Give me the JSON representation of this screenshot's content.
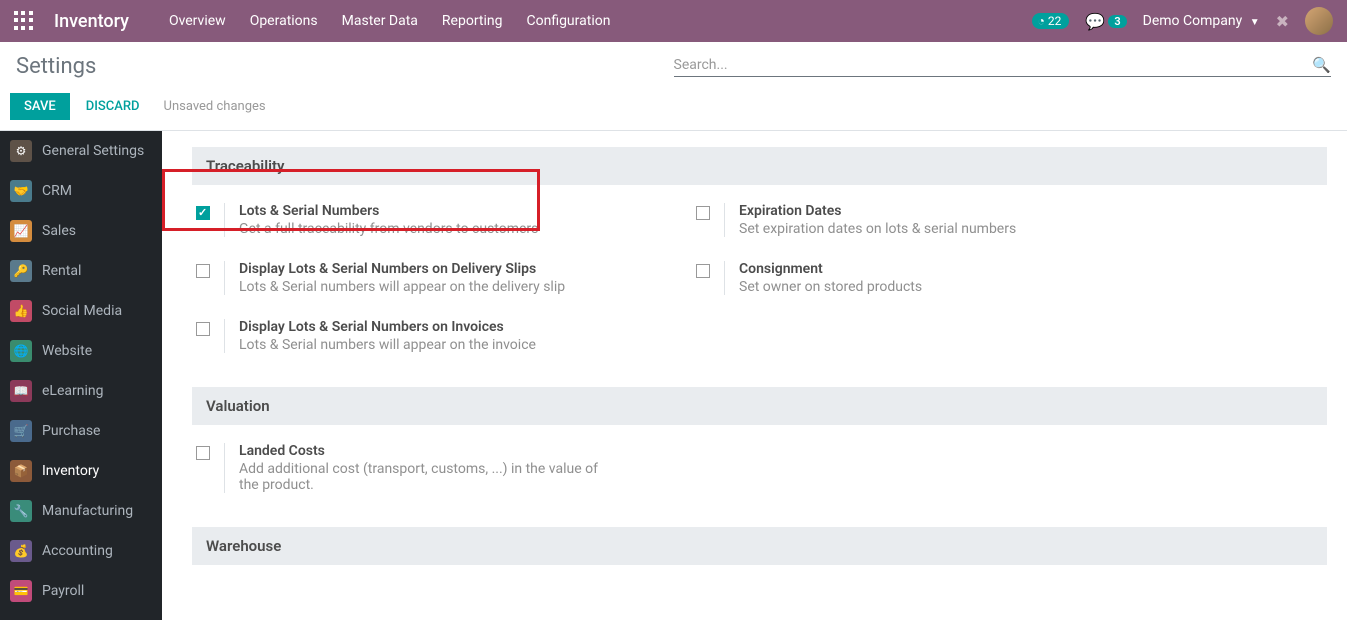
{
  "navbar": {
    "brand": "Inventory",
    "menu": [
      "Overview",
      "Operations",
      "Master Data",
      "Reporting",
      "Configuration"
    ],
    "clock_count": "22",
    "chat_count": "3",
    "company": "Demo Company"
  },
  "control_panel": {
    "title": "Settings",
    "search_placeholder": "Search...",
    "save_label": "SAVE",
    "discard_label": "DISCARD",
    "unsaved_label": "Unsaved changes"
  },
  "sidebar": {
    "items": [
      {
        "label": "General Settings"
      },
      {
        "label": "CRM"
      },
      {
        "label": "Sales"
      },
      {
        "label": "Rental"
      },
      {
        "label": "Social Media"
      },
      {
        "label": "Website"
      },
      {
        "label": "eLearning"
      },
      {
        "label": "Purchase"
      },
      {
        "label": "Inventory"
      },
      {
        "label": "Manufacturing"
      },
      {
        "label": "Accounting"
      },
      {
        "label": "Payroll"
      }
    ]
  },
  "sections": {
    "traceability": {
      "title": "Traceability",
      "left": [
        {
          "title": "Lots & Serial Numbers",
          "desc": "Get a full traceability from vendors to customers",
          "checked": true
        },
        {
          "title": "Display Lots & Serial Numbers on Delivery Slips",
          "desc": "Lots & Serial numbers will appear on the delivery slip",
          "checked": false
        },
        {
          "title": "Display Lots & Serial Numbers on Invoices",
          "desc": "Lots & Serial numbers will appear on the invoice",
          "checked": false
        }
      ],
      "right": [
        {
          "title": "Expiration Dates",
          "desc": "Set expiration dates on lots & serial numbers",
          "checked": false
        },
        {
          "title": "Consignment",
          "desc": "Set owner on stored products",
          "checked": false
        }
      ]
    },
    "valuation": {
      "title": "Valuation",
      "left": [
        {
          "title": "Landed Costs",
          "desc": "Add additional cost (transport, customs, ...) in the value of the product.",
          "checked": false
        }
      ]
    },
    "warehouse": {
      "title": "Warehouse"
    }
  }
}
